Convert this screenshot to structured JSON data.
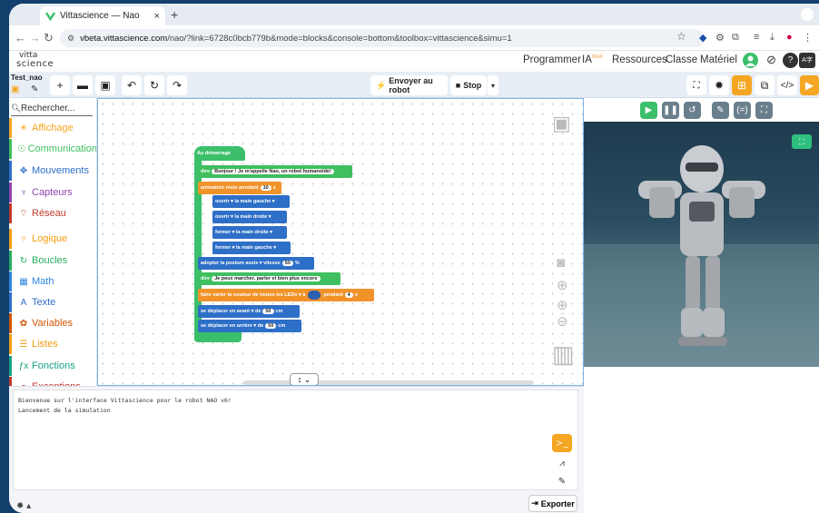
{
  "browser": {
    "tab_title": "Vittascience — Nao",
    "tab_close": "×",
    "new_tab": "+",
    "url_domain": "vbeta.vittascience.com",
    "url_path": "/nao/?link=6728c0bcb779b&mode=blocks&console=bottom&toolbox=vittascience&simu=1"
  },
  "header": {
    "logo_line1": "vitta",
    "logo_line2": "science",
    "menu": [
      "Programmer",
      "IA",
      "Ressources",
      "Classe",
      "Matériel"
    ],
    "ia_badge": "NEW"
  },
  "toolbar": {
    "project_name": "Test_nao",
    "send_label": "Envoyer au robot",
    "stop_label": "Stop"
  },
  "categories": {
    "search_placeholder": "Rechercher...",
    "items": [
      {
        "label": "Affichage",
        "color": "#f5a623",
        "icon": "☀"
      },
      {
        "label": "Communication",
        "color": "#3fbf5f",
        "icon": "☉"
      },
      {
        "label": "Mouvements",
        "color": "#2e6fc8",
        "icon": "✥"
      },
      {
        "label": "Capteurs",
        "color": "#8e44ad",
        "icon": "♆"
      },
      {
        "label": "Réseau",
        "color": "#c0392b",
        "icon": "⌔"
      },
      {
        "label": "Logique",
        "color": "#f39c12",
        "icon": "⑂"
      },
      {
        "label": "Boucles",
        "color": "#27ae60",
        "icon": "↻"
      },
      {
        "label": "Math",
        "color": "#2e86de",
        "icon": "▦"
      },
      {
        "label": "Texte",
        "color": "#2e6fc8",
        "icon": "A"
      },
      {
        "label": "Variables",
        "color": "#d35400",
        "icon": "✿"
      },
      {
        "label": "Listes",
        "color": "#f39c12",
        "icon": "☰"
      },
      {
        "label": "Fonctions",
        "color": "#16a085",
        "icon": "ƒx"
      },
      {
        "label": "Exceptions",
        "color": "#c0392b",
        "icon": "●"
      }
    ]
  },
  "blocks": {
    "start": "Au démarrage",
    "say1_kw": "dire",
    "say1_text": "Bonjour ! Je m'appelle Nao, un robot humanoïde!",
    "anim_kw": "animation reste pendant",
    "anim_val": "10",
    "anim_unit": "s",
    "hand1": {
      "action": "ouvrir",
      "mid": "la main",
      "side": "gauche"
    },
    "hand2": {
      "action": "ouvrir",
      "mid": "la main",
      "side": "droite"
    },
    "hand3": {
      "action": "fermer",
      "mid": "la main",
      "side": "droite"
    },
    "hand4": {
      "action": "fermer",
      "mid": "la main",
      "side": "gauche"
    },
    "posture_kw": "adopter la posture",
    "posture_val": "assis",
    "speed_kw": "vitesse",
    "speed_val": "50",
    "speed_unit": "%",
    "say2_kw": "dire",
    "say2_text": "Je peux marcher, parler et bien plus encore",
    "leds_kw": "faire varier la couleur",
    "leds_target": "de toutes les LEDs",
    "leds_to": "à",
    "leds_during": "pendant",
    "leds_val": "4",
    "leds_unit": "s",
    "move1_kw": "se déplacer en",
    "move1_dir": "avant",
    "move1_de": "de",
    "move1_val": "50",
    "move1_unit": "cm",
    "move2_kw": "se déplacer en",
    "move2_dir": "arrière",
    "move2_de": "de",
    "move2_val": "50",
    "move2_unit": "cm"
  },
  "console": {
    "lines": [
      "Bienvenue sur l'interface Vittascience pour le robot NAO v6!",
      "Lancement de la simulation"
    ],
    "export_label": "Exporter"
  },
  "colors": {
    "accent_orange": "#f5a623",
    "block_blue": "#2e6fc8",
    "block_green": "#3fbf5f",
    "block_orange": "#f0932b",
    "sim_button": "#6a7f8c",
    "play_button": "#3cbf6b"
  }
}
